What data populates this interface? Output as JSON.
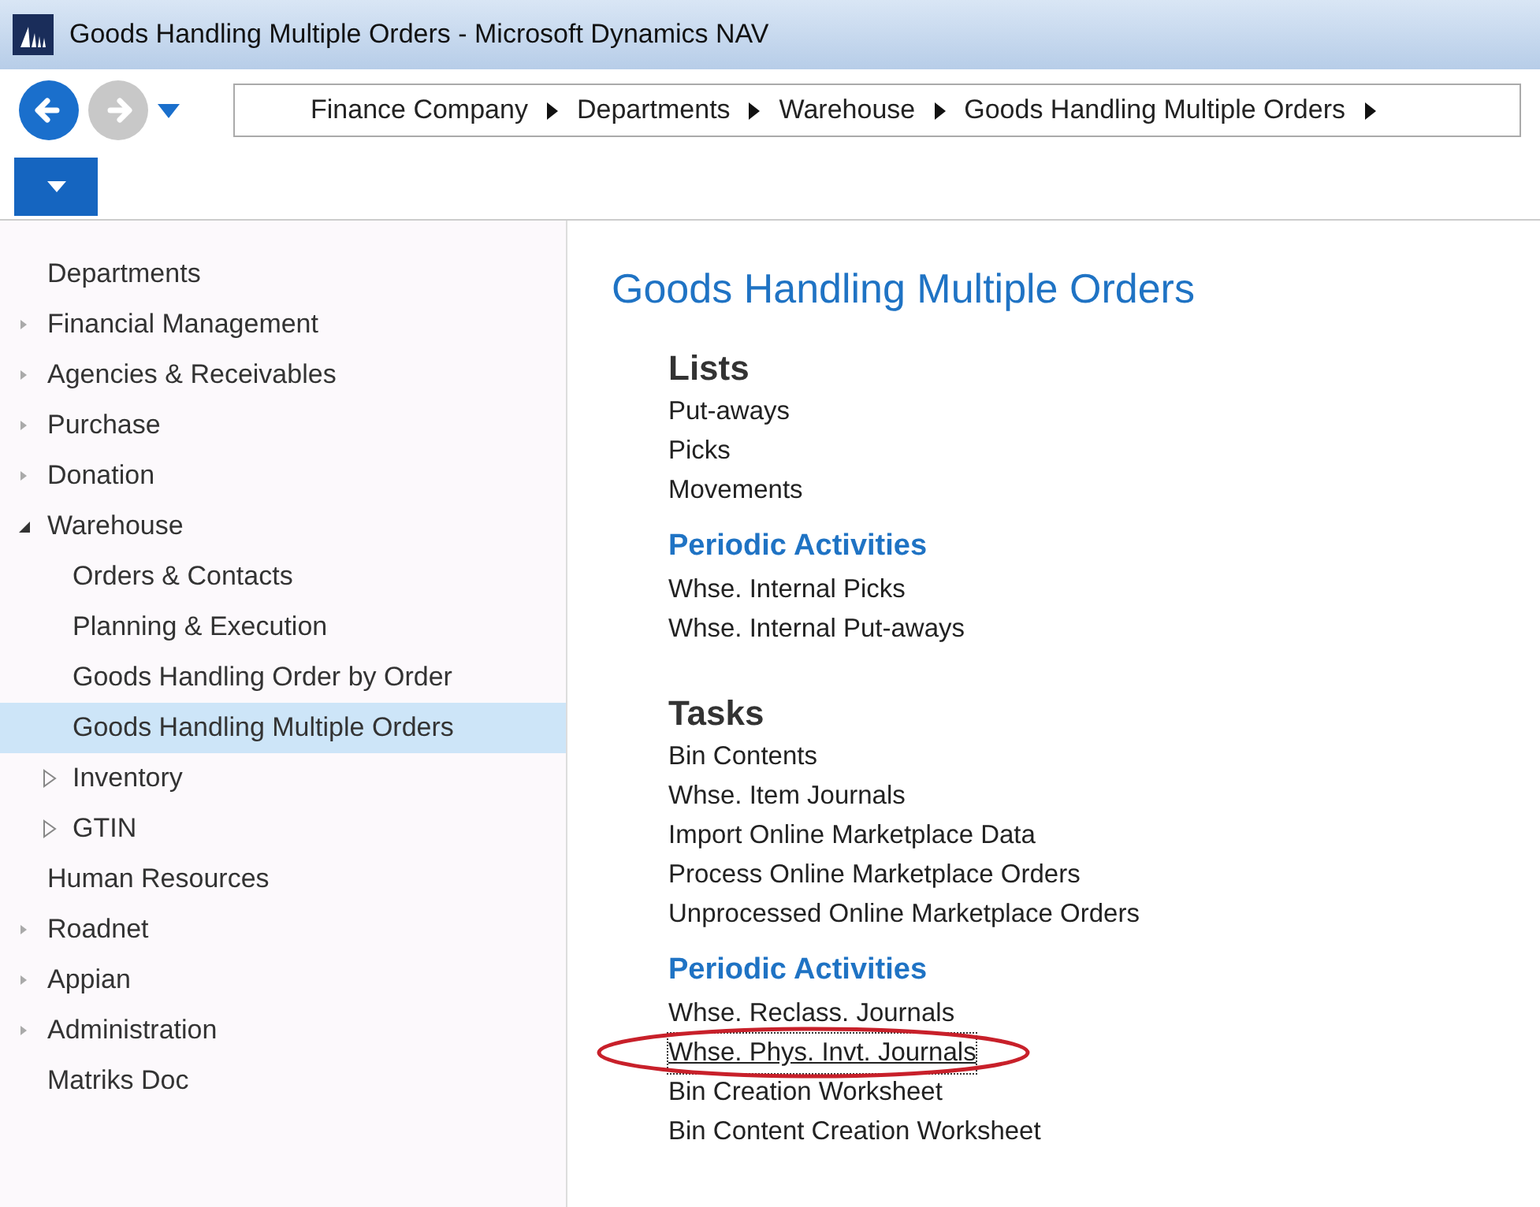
{
  "window": {
    "title": "Goods Handling Multiple Orders - Microsoft Dynamics NAV"
  },
  "breadcrumb": [
    "Finance Company",
    "Departments",
    "Warehouse",
    "Goods Handling Multiple Orders"
  ],
  "navigation": {
    "back_disabled": false,
    "forward_disabled": true
  },
  "sidebar": {
    "items": [
      {
        "label": "Departments",
        "selected": false
      },
      {
        "label": "Financial Management",
        "selected": false,
        "expanded": false
      },
      {
        "label": "Agencies & Receivables",
        "selected": false,
        "expanded": false
      },
      {
        "label": "Purchase",
        "selected": false,
        "expanded": false
      },
      {
        "label": "Donation",
        "selected": false,
        "expanded": false
      },
      {
        "label": "Warehouse",
        "selected": false,
        "expanded": true,
        "children": [
          {
            "label": "Orders & Contacts",
            "selected": false
          },
          {
            "label": "Planning & Execution",
            "selected": false
          },
          {
            "label": "Goods Handling Order by Order",
            "selected": false
          },
          {
            "label": "Goods Handling Multiple Orders",
            "selected": true
          },
          {
            "label": "Inventory",
            "selected": false,
            "expanded": false
          },
          {
            "label": "GTIN",
            "selected": false,
            "expanded": false
          }
        ]
      },
      {
        "label": "Human Resources",
        "selected": false
      },
      {
        "label": "Roadnet",
        "selected": false,
        "expanded": false
      },
      {
        "label": "Appian",
        "selected": false,
        "expanded": false
      },
      {
        "label": "Administration",
        "selected": false,
        "expanded": false
      },
      {
        "label": "Matriks Doc",
        "selected": false
      }
    ]
  },
  "page": {
    "title": "Goods Handling Multiple Orders",
    "sections": [
      {
        "kind": "group",
        "heading": "Lists",
        "items": [
          {
            "label": "Put-aways"
          },
          {
            "label": "Picks"
          },
          {
            "label": "Movements"
          }
        ]
      },
      {
        "kind": "subgroup",
        "heading": "Periodic Activities",
        "items": [
          {
            "label": "Whse. Internal Picks"
          },
          {
            "label": "Whse. Internal Put-aways"
          }
        ]
      },
      {
        "kind": "group",
        "heading": "Tasks",
        "items": [
          {
            "label": "Bin Contents"
          },
          {
            "label": "Whse. Item Journals"
          },
          {
            "label": "Import Online Marketplace Data"
          },
          {
            "label": "Process Online Marketplace Orders"
          },
          {
            "label": "Unprocessed Online Marketplace Orders"
          }
        ]
      },
      {
        "kind": "subgroup",
        "heading": "Periodic Activities",
        "items": [
          {
            "label": "Whse. Reclass. Journals"
          },
          {
            "label": "Whse. Phys. Invt. Journals",
            "focused": true,
            "circled": true
          },
          {
            "label": "Bin Creation Worksheet"
          },
          {
            "label": "Bin Content Creation Worksheet"
          }
        ]
      }
    ]
  }
}
